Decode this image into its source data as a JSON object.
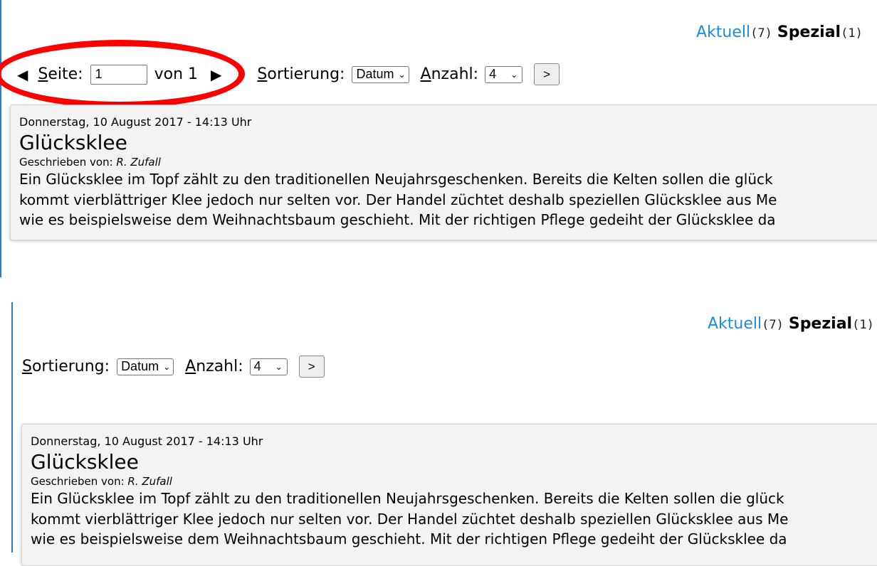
{
  "categories": [
    {
      "label": "Aktuell",
      "count": "(7)"
    },
    {
      "label": "Spezial",
      "count": "(1)"
    }
  ],
  "pager": {
    "prev_icon": "triangle-left-icon",
    "next_icon": "triangle-right-icon",
    "page_label": "Seite:",
    "page_value": "1",
    "of_label": "von 1"
  },
  "controls": {
    "sort_label": "Sortierung:",
    "sort_value": "Datum",
    "count_label": "Anzahl:",
    "count_value": "4",
    "go_label": ">"
  },
  "articles": [
    {
      "date": "Donnerstag, 10 August 2017 - 14:13 Uhr",
      "title": "Glücksklee",
      "author_prefix": "Geschrieben von:",
      "author": "R. Zufall",
      "lines": [
        "Ein Glücksklee im Topf zählt zu den traditionellen Neujahrsgeschenken. Bereits die Kelten sollen die glück",
        "kommt vierblättriger Klee jedoch nur selten vor. Der Handel züchtet deshalb speziellen Glücksklee aus Me",
        "wie es beispielsweise dem Weihnachtsbaum geschieht. Mit der richtigen Pflege gedeiht der Glücksklee da"
      ]
    }
  ],
  "colors": {
    "link": "#1a8fdc",
    "highlight": "#ff0000",
    "border_accent": "#1e7fd6"
  }
}
